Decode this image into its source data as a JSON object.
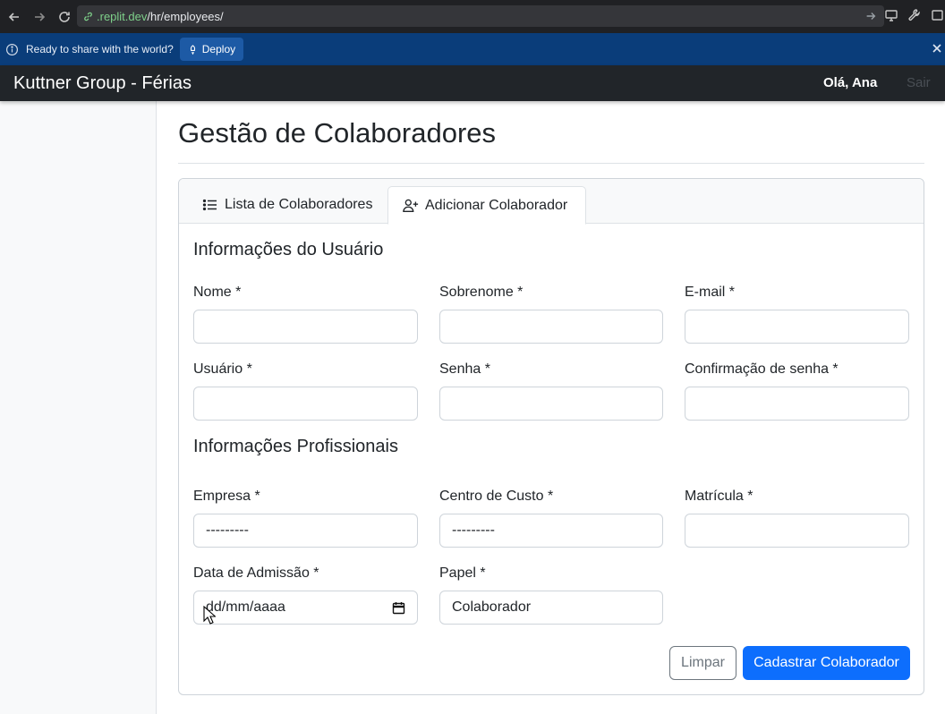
{
  "browser": {
    "url_host": ".replit.dev",
    "url_path": "/hr/employees/"
  },
  "deploy_bar": {
    "message": "Ready to share with the world?",
    "deploy_label": "Deploy"
  },
  "navbar": {
    "brand": "Kuttner Group - Férias",
    "greeting": "Olá, Ana",
    "logout": "Sair"
  },
  "page": {
    "title": "Gestão de Colaboradores"
  },
  "tabs": [
    {
      "label": "Lista de Colaboradores",
      "icon": "list-icon",
      "active": false
    },
    {
      "label": "Adicionar Colaborador",
      "icon": "user-plus-icon",
      "active": true
    }
  ],
  "form": {
    "user_section_title": "Informações do Usuário",
    "professional_section_title": "Informações Profissionais",
    "fields": {
      "nome": {
        "label": "Nome *",
        "value": ""
      },
      "sobrenome": {
        "label": "Sobrenome *",
        "value": ""
      },
      "email": {
        "label": "E-mail *",
        "value": ""
      },
      "usuario": {
        "label": "Usuário *",
        "value": ""
      },
      "senha": {
        "label": "Senha *",
        "value": ""
      },
      "confirmacao": {
        "label": "Confirmação de senha *",
        "value": ""
      },
      "empresa": {
        "label": "Empresa *",
        "value": "---------"
      },
      "centro_custo": {
        "label": "Centro de Custo *",
        "value": "---------"
      },
      "matricula": {
        "label": "Matrícula *",
        "value": ""
      },
      "data_admissao": {
        "label": "Data de Admissão *",
        "value": "dd/mm/aaaa"
      },
      "papel": {
        "label": "Papel *",
        "value": "Colaborador"
      }
    },
    "clear_label": "Limpar",
    "submit_label": "Cadastrar Colaborador"
  },
  "colors": {
    "primary": "#0d6efd",
    "navbar_bg": "#212529",
    "deploy_bar_bg": "#0a3d7a"
  }
}
